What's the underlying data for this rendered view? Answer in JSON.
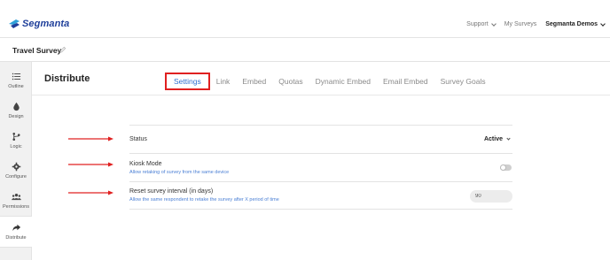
{
  "app": {
    "brand_name": "Segmanta",
    "brand_color": "#1f3f9a"
  },
  "topnav": {
    "support": "Support",
    "my_surveys": "My Surveys",
    "account": "Segmanta Demos"
  },
  "survey": {
    "title": "Travel Survey"
  },
  "sidebar": {
    "items": [
      {
        "label": "Outline",
        "icon": "list-icon"
      },
      {
        "label": "Design",
        "icon": "drop-icon"
      },
      {
        "label": "Logic",
        "icon": "branch-icon"
      },
      {
        "label": "Configure",
        "icon": "gear-icon"
      },
      {
        "label": "Permissions",
        "icon": "users-icon"
      },
      {
        "label": "Distribute",
        "icon": "share-icon",
        "active": true
      }
    ]
  },
  "main": {
    "title": "Distribute",
    "tabs": [
      {
        "label": "Settings",
        "active": true
      },
      {
        "label": "Link"
      },
      {
        "label": "Embed"
      },
      {
        "label": "Quotas"
      },
      {
        "label": "Dynamic Embed"
      },
      {
        "label": "Email Embed"
      },
      {
        "label": "Survey Goals"
      }
    ]
  },
  "settings": {
    "status": {
      "label": "Status",
      "value": "Active"
    },
    "kiosk": {
      "label": "Kiosk Mode",
      "description": "Allow retaking of survey from the same device",
      "enabled": false
    },
    "reset": {
      "label": "Reset survey interval (in days)",
      "description": "Allow the same respondent to retake the survey after X period of time",
      "value": "90"
    }
  },
  "colors": {
    "accent": "#2f6fd0",
    "annotation": "#e02020",
    "link_text": "#4a7fd4"
  }
}
